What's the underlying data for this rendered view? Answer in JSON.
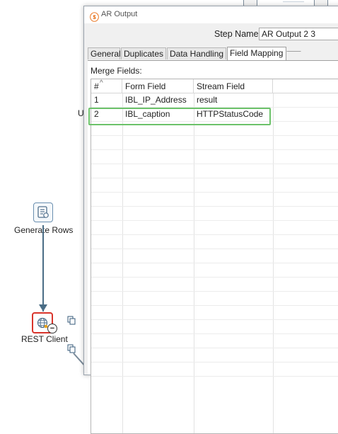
{
  "canvas": {
    "steps": [
      {
        "label": "Generate Rows",
        "icon": "generate-rows-icon"
      },
      {
        "label": "REST Client",
        "icon": "rest-client-icon"
      }
    ],
    "stray_text": "U"
  },
  "dialog": {
    "title": "AR Output",
    "title_icon": "pentaho-spoon-icon",
    "step_name_label": "Step Name",
    "step_name_value": "AR Output 2 3",
    "tabs": [
      {
        "label": "General",
        "active": false
      },
      {
        "label": "Duplicates",
        "active": false
      },
      {
        "label": "Data Handling",
        "active": false
      },
      {
        "label": "Field Mapping",
        "active": true
      }
    ],
    "merge_fields_label": "Merge Fields:",
    "table": {
      "columns": [
        "#",
        "Form Field",
        "Stream Field"
      ],
      "rows": [
        {
          "num": "1",
          "form_field": "IBL_IP_Address",
          "stream_field": "result"
        },
        {
          "num": "2",
          "form_field": "IBL_caption",
          "stream_field": "HTTPStatusCode"
        }
      ],
      "highlight_color": "#6cc26a"
    }
  },
  "colors": {
    "hop_line": "#4a6d86",
    "rest_error_border": "#d9342b",
    "title_icon": "#e8711a"
  }
}
